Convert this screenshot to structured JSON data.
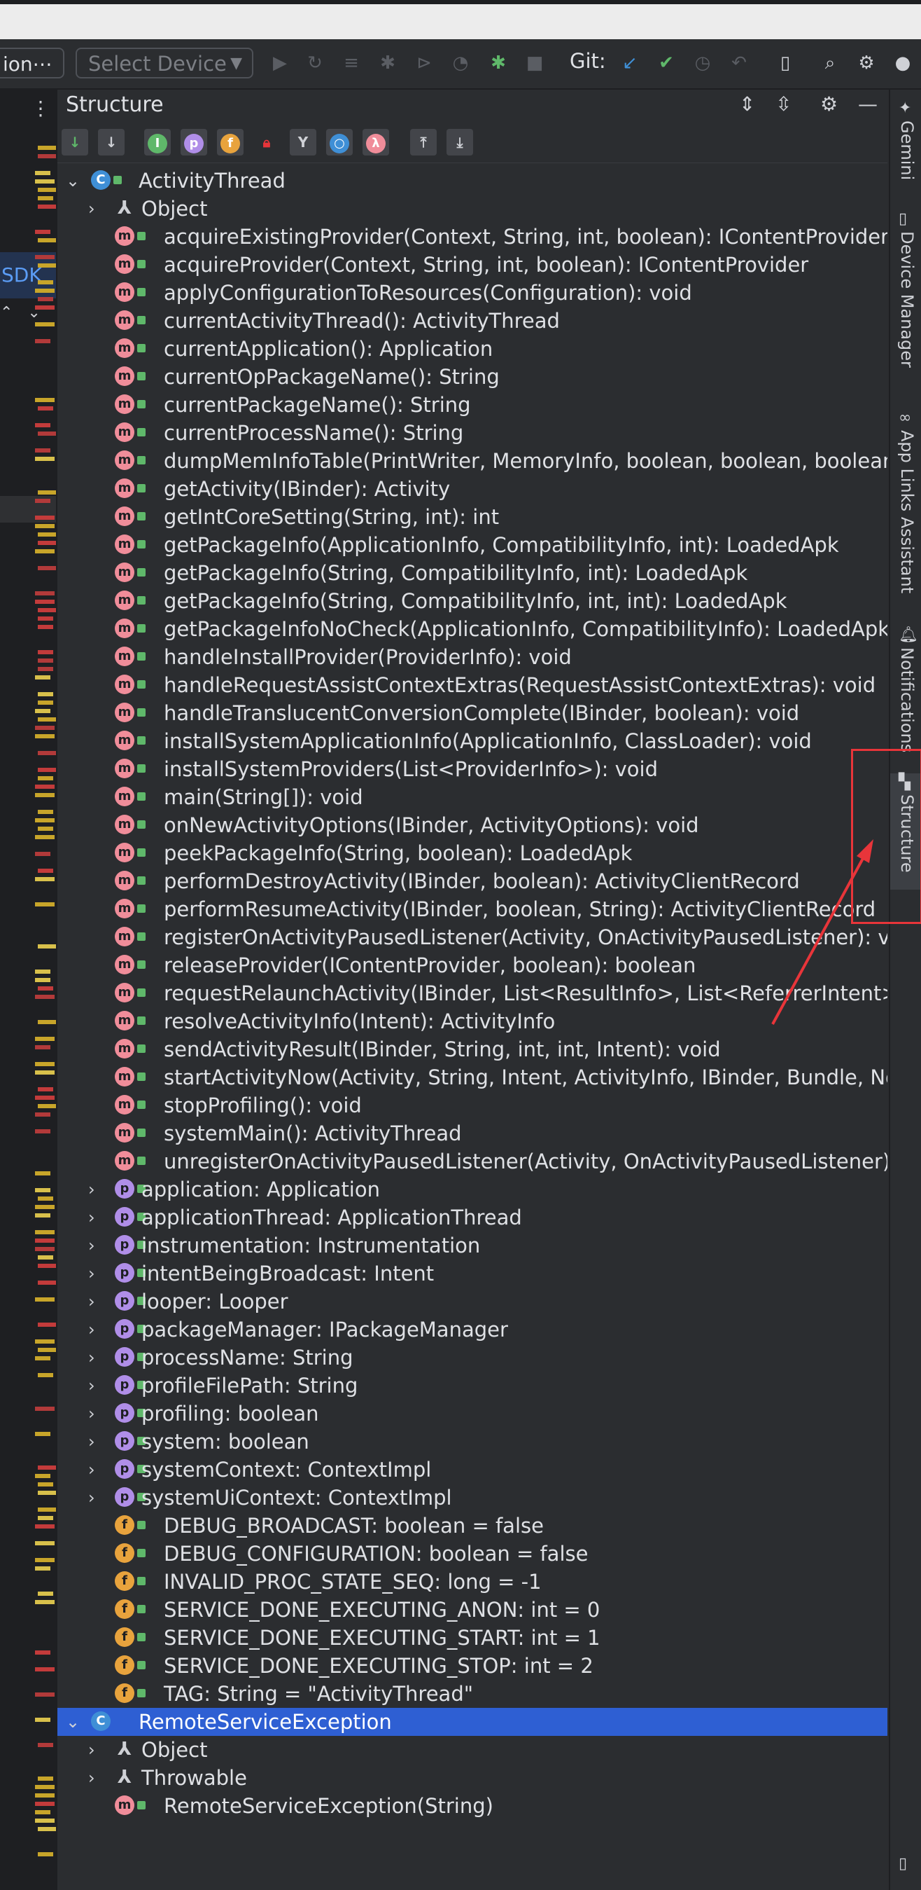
{
  "toolbar": {
    "config_label": "ion⋯",
    "device_select": "Select Device",
    "git_label": "Git:"
  },
  "left": {
    "sdk_label": "SDK"
  },
  "panel": {
    "title": "Structure"
  },
  "tree": [
    {
      "level": 0,
      "icon": "c",
      "label": "ActivityThread",
      "expander": "open",
      "lock": true
    },
    {
      "level": 1,
      "icon": "o",
      "label": "Object",
      "expander": "closed",
      "lock": false
    },
    {
      "level": 2,
      "icon": "m",
      "label": "acquireExistingProvider(Context, String, int, boolean): IContentProvider",
      "lock": true
    },
    {
      "level": 2,
      "icon": "m",
      "label": "acquireProvider(Context, String, int, boolean): IContentProvider",
      "lock": true
    },
    {
      "level": 2,
      "icon": "m",
      "label": "applyConfigurationToResources(Configuration): void",
      "lock": true
    },
    {
      "level": 2,
      "icon": "m",
      "label": "currentActivityThread(): ActivityThread",
      "lock": true
    },
    {
      "level": 2,
      "icon": "m",
      "label": "currentApplication(): Application",
      "lock": true
    },
    {
      "level": 2,
      "icon": "m",
      "label": "currentOpPackageName(): String",
      "lock": true
    },
    {
      "level": 2,
      "icon": "m",
      "label": "currentPackageName(): String",
      "lock": true
    },
    {
      "level": 2,
      "icon": "m",
      "label": "currentProcessName(): String",
      "lock": true
    },
    {
      "level": 2,
      "icon": "m",
      "label": "dumpMemInfoTable(PrintWriter, MemoryInfo, boolean, boolean, boolean,",
      "lock": true
    },
    {
      "level": 2,
      "icon": "m",
      "label": "getActivity(IBinder): Activity",
      "lock": true
    },
    {
      "level": 2,
      "icon": "m",
      "label": "getIntCoreSetting(String, int): int",
      "lock": true
    },
    {
      "level": 2,
      "icon": "m",
      "label": "getPackageInfo(ApplicationInfo, CompatibilityInfo, int): LoadedApk",
      "lock": true
    },
    {
      "level": 2,
      "icon": "m",
      "label": "getPackageInfo(String, CompatibilityInfo, int): LoadedApk",
      "lock": true
    },
    {
      "level": 2,
      "icon": "m",
      "label": "getPackageInfo(String, CompatibilityInfo, int, int): LoadedApk",
      "lock": true
    },
    {
      "level": 2,
      "icon": "m",
      "label": "getPackageInfoNoCheck(ApplicationInfo, CompatibilityInfo): LoadedApk",
      "lock": true
    },
    {
      "level": 2,
      "icon": "m",
      "label": "handleInstallProvider(ProviderInfo): void",
      "lock": true
    },
    {
      "level": 2,
      "icon": "m",
      "label": "handleRequestAssistContextExtras(RequestAssistContextExtras): void",
      "lock": true
    },
    {
      "level": 2,
      "icon": "m",
      "label": "handleTranslucentConversionComplete(IBinder, boolean): void",
      "lock": true
    },
    {
      "level": 2,
      "icon": "m",
      "label": "installSystemApplicationInfo(ApplicationInfo, ClassLoader): void",
      "lock": true
    },
    {
      "level": 2,
      "icon": "m",
      "label": "installSystemProviders(List<ProviderInfo>): void",
      "lock": true
    },
    {
      "level": 2,
      "icon": "m",
      "label": "main(String[]): void",
      "lock": true
    },
    {
      "level": 2,
      "icon": "m",
      "label": "onNewActivityOptions(IBinder, ActivityOptions): void",
      "lock": true
    },
    {
      "level": 2,
      "icon": "m",
      "label": "peekPackageInfo(String, boolean): LoadedApk",
      "lock": true
    },
    {
      "level": 2,
      "icon": "m",
      "label": "performDestroyActivity(IBinder, boolean): ActivityClientRecord",
      "lock": true
    },
    {
      "level": 2,
      "icon": "m",
      "label": "performResumeActivity(IBinder, boolean, String): ActivityClientRecord",
      "lock": true
    },
    {
      "level": 2,
      "icon": "m",
      "label": "registerOnActivityPausedListener(Activity, OnActivityPausedListener): void",
      "lock": true
    },
    {
      "level": 2,
      "icon": "m",
      "label": "releaseProvider(IContentProvider, boolean): boolean",
      "lock": true
    },
    {
      "level": 2,
      "icon": "m",
      "label": "requestRelaunchActivity(IBinder, List<ResultInfo>, List<ReferrerIntent>, in",
      "lock": true
    },
    {
      "level": 2,
      "icon": "m",
      "label": "resolveActivityInfo(Intent): ActivityInfo",
      "lock": true
    },
    {
      "level": 2,
      "icon": "m",
      "label": "sendActivityResult(IBinder, String, int, int, Intent): void",
      "lock": true
    },
    {
      "level": 2,
      "icon": "m",
      "label": "startActivityNow(Activity, String, Intent, ActivityInfo, IBinder, Bundle, NonC",
      "lock": true
    },
    {
      "level": 2,
      "icon": "m",
      "label": "stopProfiling(): void",
      "lock": true
    },
    {
      "level": 2,
      "icon": "m",
      "label": "systemMain(): ActivityThread",
      "lock": true
    },
    {
      "level": 2,
      "icon": "m",
      "label": "unregisterOnActivityPausedListener(Activity, OnActivityPausedListener): vo",
      "lock": true
    },
    {
      "level": 1,
      "icon": "p",
      "label": "application: Application",
      "expander": "closed",
      "lock": true
    },
    {
      "level": 1,
      "icon": "p",
      "label": "applicationThread: ApplicationThread",
      "expander": "closed",
      "lock": true
    },
    {
      "level": 1,
      "icon": "p",
      "label": "instrumentation: Instrumentation",
      "expander": "closed",
      "lock": true
    },
    {
      "level": 1,
      "icon": "p",
      "label": "intentBeingBroadcast: Intent",
      "expander": "closed",
      "lock": true
    },
    {
      "level": 1,
      "icon": "p",
      "label": "looper: Looper",
      "expander": "closed",
      "lock": true
    },
    {
      "level": 1,
      "icon": "p",
      "label": "packageManager: IPackageManager",
      "expander": "closed",
      "lock": true
    },
    {
      "level": 1,
      "icon": "p",
      "label": "processName: String",
      "expander": "closed",
      "lock": true
    },
    {
      "level": 1,
      "icon": "p",
      "label": "profileFilePath: String",
      "expander": "closed",
      "lock": true
    },
    {
      "level": 1,
      "icon": "p",
      "label": "profiling: boolean",
      "expander": "closed",
      "lock": true
    },
    {
      "level": 1,
      "icon": "p",
      "label": "system: boolean",
      "expander": "closed",
      "lock": true
    },
    {
      "level": 1,
      "icon": "p",
      "label": "systemContext: ContextImpl",
      "expander": "closed",
      "lock": true
    },
    {
      "level": 1,
      "icon": "p",
      "label": "systemUiContext: ContextImpl",
      "expander": "closed",
      "lock": true
    },
    {
      "level": 2,
      "icon": "f",
      "label": "DEBUG_BROADCAST: boolean = false",
      "lock": true
    },
    {
      "level": 2,
      "icon": "f",
      "label": "DEBUG_CONFIGURATION: boolean = false",
      "lock": true
    },
    {
      "level": 2,
      "icon": "f",
      "label": "INVALID_PROC_STATE_SEQ: long = -1",
      "lock": true
    },
    {
      "level": 2,
      "icon": "f",
      "label": "SERVICE_DONE_EXECUTING_ANON: int = 0",
      "lock": true
    },
    {
      "level": 2,
      "icon": "f",
      "label": "SERVICE_DONE_EXECUTING_START: int = 1",
      "lock": true
    },
    {
      "level": 2,
      "icon": "f",
      "label": "SERVICE_DONE_EXECUTING_STOP: int = 2",
      "lock": true
    },
    {
      "level": 2,
      "icon": "f",
      "label": "TAG: String = \"ActivityThread\"",
      "lock": true
    },
    {
      "level": 0,
      "icon": "c",
      "label": "RemoteServiceException",
      "expander": "open",
      "lock": false,
      "selected": true
    },
    {
      "level": 1,
      "icon": "o",
      "label": "Object",
      "expander": "closed",
      "lock": false
    },
    {
      "level": 1,
      "icon": "o",
      "label": "Throwable",
      "expander": "closed",
      "lock": false
    },
    {
      "level": 2,
      "icon": "m",
      "label": "RemoteServiceException(String)",
      "lock": true
    }
  ],
  "right_tabs": [
    {
      "label": "Gemini",
      "icon": "sparkle-icon"
    },
    {
      "label": "Device Manager",
      "icon": "device-icon"
    },
    {
      "label": "App Links Assistant",
      "icon": "link-icon"
    },
    {
      "label": "Notifications",
      "icon": "bell-icon"
    },
    {
      "label": "Structure",
      "icon": "structure-icon",
      "active": true
    }
  ],
  "colors": {
    "selection": "#2e5fd3",
    "annotation": "#e8353a",
    "method_icon": "#f08d9a",
    "property_icon": "#b08ee8",
    "field_icon": "#e8a33d"
  }
}
